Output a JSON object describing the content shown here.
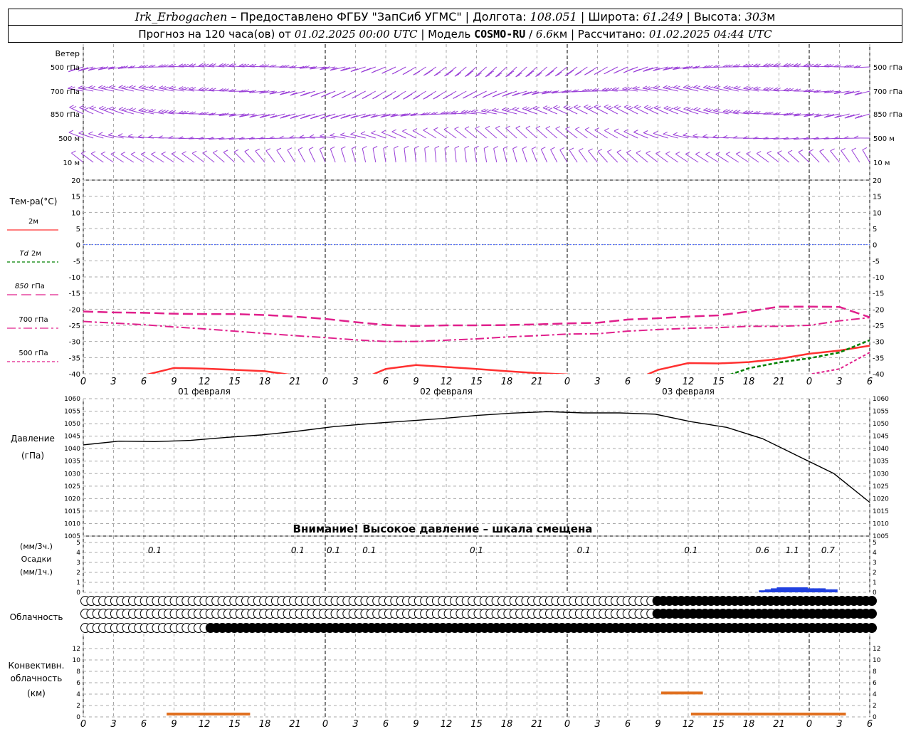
{
  "header": {
    "station": "Irk_Erbogachen",
    "provider": " – Предоставлено ФГБУ \"ЗапСиб УГМС\" | Долгота: ",
    "lon": "108.051",
    "lat_label": " | Широта: ",
    "lat": "61.249",
    "alt_label": " | Высота: ",
    "alt": "303",
    "alt_unit": "м",
    "forecast_label": "Прогноз на 120 часа(ов) от ",
    "run_time": "01.02.2025 00:00 UTC",
    "model_label": " | Модель ",
    "model": "COSMO-RU",
    "model_sep": " / ",
    "resolution": "6.6",
    "res_unit": "км",
    "calc_label": " | Рассчитано: ",
    "calc_time": "01.02.2025 04:44 UTC"
  },
  "panels": {
    "wind": {
      "title": "Ветер",
      "levels": [
        "500 гПа",
        "700 гПа",
        "850 гПа",
        "500 м",
        "10 м"
      ]
    },
    "temperature": {
      "title": "Тем-ра(°C)",
      "legend": [
        {
          "label": "2м",
          "color": "#ff3030",
          "dash": "solid"
        },
        {
          "label_it": "Td",
          "label": "2м",
          "color": "#008000",
          "dash": "dashed"
        },
        {
          "label_it": "850",
          "label": "гПа",
          "color": "#e0208c",
          "dash": "longdash"
        },
        {
          "label": "700 гПа",
          "color": "#e0208c",
          "dash": "dashdot"
        },
        {
          "label": "500 гПа",
          "color": "#e0208c",
          "dash": "dashed"
        }
      ],
      "ticks": [
        "20",
        "15",
        "10",
        "5",
        "0",
        "-5",
        "-10",
        "-15",
        "-20",
        "-25",
        "-30",
        "-35",
        "-40"
      ]
    },
    "pressure": {
      "title": "Давление",
      "unit": "(гПа)",
      "ticks": [
        "1060",
        "1055",
        "1050",
        "1045",
        "1040",
        "1035",
        "1030",
        "1025",
        "1020",
        "1015",
        "1010",
        "1005"
      ],
      "warning": "Внимание! Высокое давление – шкала смещена"
    },
    "precip": {
      "unit3": "(мм/3ч.)",
      "title": "Осадки",
      "unit1": "(мм/1ч.)",
      "ticks": [
        "5",
        "4",
        "3",
        "2",
        "1",
        "0"
      ],
      "totals": [
        {
          "h": 12,
          "v": "0.1"
        },
        {
          "h": 36,
          "v": "0.1"
        },
        {
          "h": 42,
          "v": "0.1"
        },
        {
          "h": 48,
          "v": "0.1"
        },
        {
          "h": 66,
          "v": "0.1"
        },
        {
          "h": 84,
          "v": "0.1"
        },
        {
          "h": 102,
          "v": "0.1"
        },
        {
          "h": 114,
          "v": "0.6"
        },
        {
          "h": 119,
          "v": "1.1"
        },
        {
          "h": 125,
          "v": "0.7"
        }
      ]
    },
    "cloud": {
      "title": "Облачность"
    },
    "convective": {
      "title1": "Конвективн.",
      "title2": "облачность",
      "unit": "(км)",
      "ticks": [
        "12",
        "10",
        "8",
        "6",
        "4",
        "2",
        "0"
      ]
    }
  },
  "time_axis": {
    "hour_labels": [
      "0",
      "3",
      "6",
      "9",
      "12",
      "15",
      "18",
      "21",
      "0",
      "3",
      "6",
      "9",
      "12",
      "15",
      "18",
      "21",
      "0",
      "3",
      "6",
      "9",
      "12",
      "15",
      "18",
      "21",
      "0",
      "3",
      "6"
    ],
    "day_labels": [
      "01 февраля",
      "02 февраля",
      "03 февраля"
    ]
  },
  "colors": {
    "wind": "#9a40d8",
    "t2m": "#ff3030",
    "td2m": "#008000",
    "upper": "#e0208c",
    "zero_line": "#4060ff",
    "precip": "#2040e0",
    "convective": "#e07020",
    "grid": "#a8a8a8"
  },
  "chart_data": [
    {
      "type": "line",
      "title": "Тем-ра(°C)",
      "ylim": [
        -40,
        20
      ],
      "x_hours": [
        0,
        3,
        6,
        9,
        12,
        15,
        18,
        21,
        24,
        27,
        30,
        33,
        36,
        39,
        42,
        45,
        48,
        51,
        54,
        57,
        60,
        63,
        66,
        69,
        72,
        75,
        78
      ],
      "series": [
        {
          "name": "2м",
          "values": [
            -43,
            -42,
            -40.5,
            -38.2,
            -38.4,
            -38.8,
            -39.2,
            -40.5,
            -43,
            -42.5,
            -38.5,
            -37.3,
            -37.9,
            -38.5,
            -39.2,
            -39.8,
            -40.2,
            -43,
            -42.8,
            -38.8,
            -36.7,
            -36.8,
            -36.4,
            -35.4,
            -33.8,
            -32.8,
            -31.3
          ]
        },
        {
          "name": "Td 2м",
          "values": [
            -45,
            -45,
            -45,
            -45,
            -45,
            -45,
            -45,
            -45,
            -45,
            -45,
            -45,
            -45,
            -45,
            -45,
            -45,
            -45,
            -45,
            -45,
            -45,
            -40.1,
            -44,
            -41.5,
            -38.3,
            -36.5,
            -35.2,
            -33.4,
            -29.6
          ]
        },
        {
          "name": "850 гПа",
          "values": [
            -20.7,
            -21,
            -21.1,
            -21.4,
            -21.5,
            -21.5,
            -21.8,
            -22.3,
            -23,
            -24,
            -24.9,
            -25.2,
            -25,
            -25,
            -24.9,
            -24.7,
            -24.4,
            -24.2,
            -23.2,
            -22.8,
            -22.3,
            -21.9,
            -20.7,
            -19.2,
            -19.2,
            -19.3,
            -22.5
          ]
        },
        {
          "name": "700 гПа",
          "values": [
            -23.8,
            -24.3,
            -24.8,
            -25.5,
            -26.1,
            -26.8,
            -27.5,
            -28.2,
            -28.8,
            -29.5,
            -30,
            -30,
            -29.6,
            -29.2,
            -28.6,
            -28.2,
            -27.7,
            -27.6,
            -26.8,
            -26.3,
            -25.9,
            -25.7,
            -25.3,
            -25.3,
            -25,
            -23.6,
            -22.6
          ]
        },
        {
          "name": "500 гПа",
          "values": [
            -45,
            -45,
            -45,
            -45,
            -45,
            -45,
            -45,
            -45,
            -45,
            -45,
            -45,
            -45,
            -45,
            -45,
            -45,
            -45,
            -45,
            -45,
            -45,
            -45,
            -45,
            -45,
            -45,
            -45,
            -40.2,
            -38.5,
            -33.4
          ]
        }
      ]
    },
    {
      "type": "line",
      "title": "Давление",
      "ylim": [
        1005,
        1060
      ],
      "x_hours": [
        0,
        6,
        12,
        18,
        24,
        30,
        36,
        42,
        48,
        54,
        60,
        66,
        72,
        78,
        84,
        90,
        96,
        102,
        108,
        114,
        120,
        126,
        132
      ],
      "series": [
        {
          "name": "Давление",
          "values": [
            1041.5,
            1043,
            1042.8,
            1043.3,
            1044.5,
            1045.5,
            1047,
            1048.8,
            1050,
            1051,
            1052,
            1053.3,
            1054.2,
            1054.8,
            1054.3,
            1054.3,
            1053.8,
            1050.8,
            1048.5,
            1044,
            1037,
            1030,
            1018.5
          ]
        }
      ]
    },
    {
      "type": "bar",
      "title": "Осадки",
      "ylim": [
        0,
        5
      ],
      "x_hours": [
        114,
        115,
        116,
        117,
        118,
        119,
        120,
        121,
        122,
        123,
        124,
        125,
        126
      ],
      "values": [
        0.2,
        0.3,
        0.4,
        0.5,
        0.5,
        0.5,
        0.5,
        0.5,
        0.4,
        0.4,
        0.4,
        0.3,
        0.3
      ]
    },
    {
      "type": "bar",
      "title": "Конвективн. облачность",
      "ylim": [
        0,
        14
      ],
      "values_km": [
        {
          "from": 14,
          "to": 28,
          "value": 0.5
        },
        {
          "from": 97,
          "to": 104,
          "value": 4.2
        },
        {
          "from": 102,
          "to": 128,
          "value": 0.5
        }
      ]
    }
  ]
}
